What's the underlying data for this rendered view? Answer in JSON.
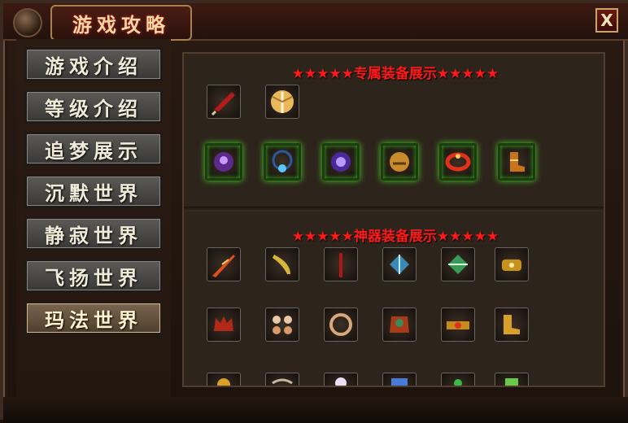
{
  "window": {
    "title": "游戏攻略",
    "close_label": "X"
  },
  "sidebar": {
    "items": [
      {
        "label": "游戏介绍"
      },
      {
        "label": "等级介绍"
      },
      {
        "label": "追梦展示"
      },
      {
        "label": "沉默世界"
      },
      {
        "label": "静寂世界"
      },
      {
        "label": "飞扬世界"
      },
      {
        "label": "玛法世界",
        "active": true
      }
    ]
  },
  "sections": {
    "exclusive": {
      "title": "★★★★★专属装备展示★★★★★"
    },
    "artifact": {
      "title": "★★★★★神器装备展示★★★★★"
    }
  },
  "colors": {
    "title_red": "#ff1a1a",
    "glow_green": "#4cd12a",
    "accent_gold": "#c9a46a"
  },
  "items": {
    "exclusive_row1": [
      "red-blade-icon",
      "golden-wings-icon"
    ],
    "exclusive_row2": [
      "purple-helmet-icon",
      "blue-necklace-icon",
      "purple-orb-icon",
      "golden-beast-icon",
      "red-ring-icon",
      "golden-boots-icon"
    ],
    "artifact_row1": [
      "flame-sword-icon",
      "golden-blade-icon",
      "red-staff-icon",
      "blue-crystal-icon",
      "green-crystal-icon",
      "golden-bracer-icon"
    ],
    "artifact_row2": [
      "demon-helmet-icon",
      "flower-earrings-icon",
      "gem-necklace-icon",
      "ornate-armor-icon",
      "gold-belt-icon",
      "gold-boots-icon"
    ],
    "artifact_row3": [
      "gold-item-icon",
      "chain-item-icon",
      "white-item-icon",
      "blue-scroll-icon",
      "green-item-icon",
      "jade-item-icon"
    ]
  }
}
